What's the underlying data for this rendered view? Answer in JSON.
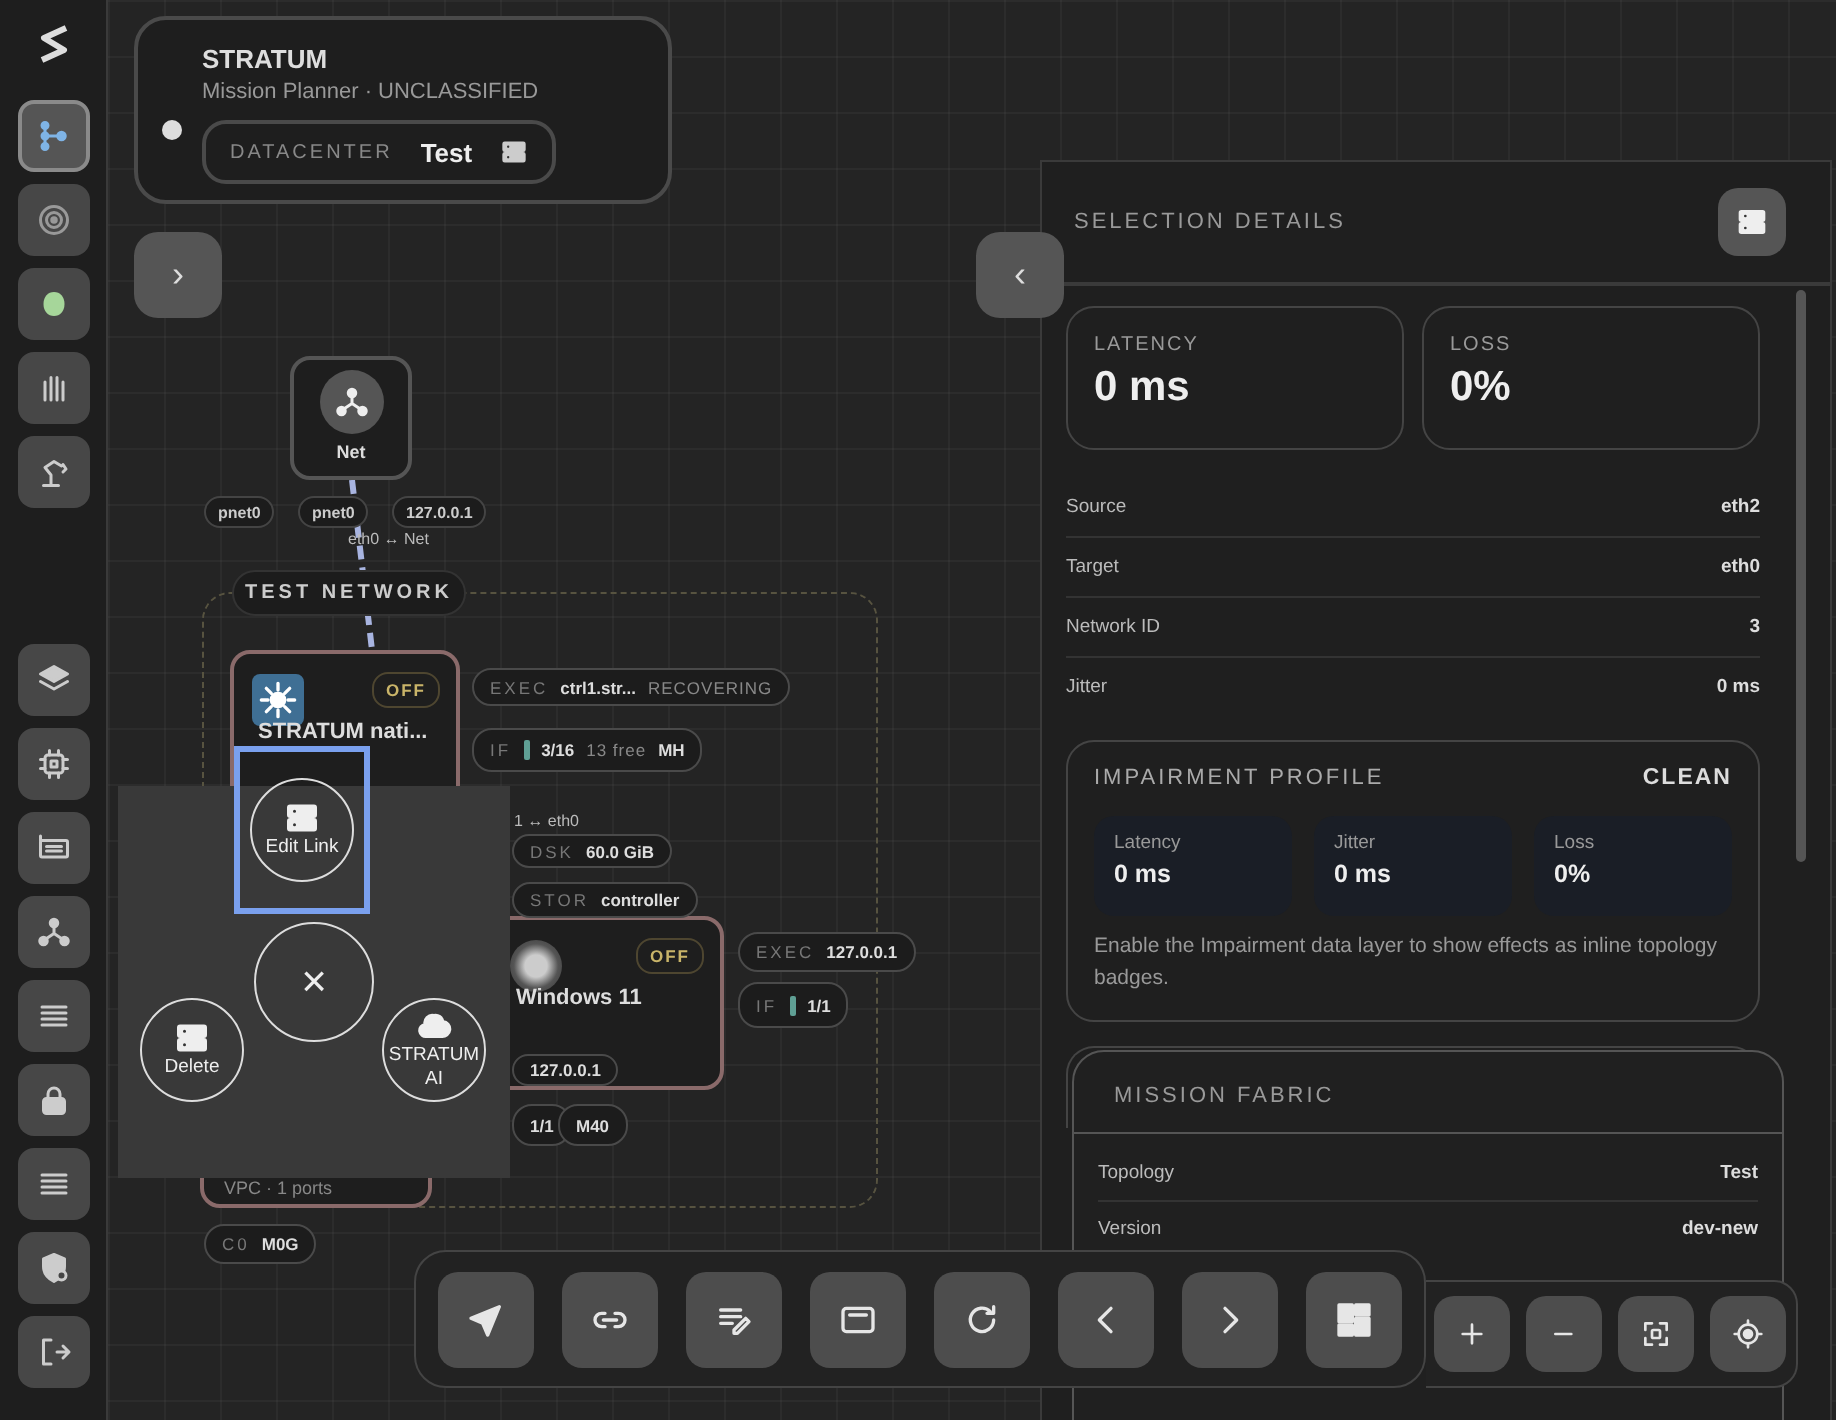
{
  "sidebar": {
    "top": [
      {
        "selected": true
      },
      {
        "selected": false
      },
      {
        "selected": false
      },
      {
        "selected": false
      },
      {
        "selected": false
      }
    ],
    "bottom": [
      {
        "selected": false
      },
      {
        "selected": false
      },
      {
        "selected": false
      },
      {
        "selected": false
      },
      {
        "selected": false
      },
      {
        "selected": false
      },
      {
        "selected": false
      },
      {
        "selected": false
      },
      {
        "selected": false
      }
    ]
  },
  "header": {
    "title": "STRATUM",
    "subtitle": "Mission Planner · UNCLASSIFIED",
    "datacenter_label": "DATACENTER",
    "datacenter_value": "Test"
  },
  "expand_button": "›",
  "collapse_button": "‹",
  "canvas": {
    "net_node": {
      "label": "Net"
    },
    "net_ports": [
      "pnet0",
      "pnet0",
      "127.0.0.1"
    ],
    "link_labels": [
      "eth0 ↔ Net",
      "1 ↔ eth0"
    ],
    "group": {
      "label": "TEST NETWORK"
    },
    "nodes": [
      {
        "kind": "controller",
        "title": "STRATUM nati...",
        "status": "OFF"
      },
      {
        "kind": "disk",
        "title": "Windows 11",
        "status": "OFF"
      },
      {
        "kind": "plain",
        "footer": "VPC · 1 ports"
      }
    ],
    "badges": [
      {
        "label": "EXEC",
        "value": "ctrl1.str...",
        "extra": "RECOVERING"
      },
      {
        "label": "IF",
        "meter": true,
        "value": "3/16",
        "extra": "13 free",
        "tail": "MH"
      },
      {
        "label": "DSK",
        "value": "60.0 GiB"
      },
      {
        "label": "STOR",
        "value": "controller"
      },
      {
        "label": "EXEC",
        "value": "127.0.0.1"
      },
      {
        "label": "IF",
        "meter": true,
        "value": "1/1"
      },
      {
        "value": "127.0.0.1"
      },
      {
        "value": "1/1"
      },
      {
        "value": "M40"
      },
      {
        "label": "C0",
        "value": "M0G"
      }
    ]
  },
  "context_menu": {
    "close": "×",
    "items": [
      {
        "label": "Edit Link",
        "selected": true
      },
      {
        "label": "Delete",
        "selected": false
      },
      {
        "label": "STRATUM AI",
        "selected": false
      }
    ]
  },
  "details": {
    "title": "SELECTION DETAILS",
    "metrics": [
      {
        "label": "LATENCY",
        "value": "0 ms"
      },
      {
        "label": "LOSS",
        "value": "0%"
      }
    ],
    "rows": [
      {
        "label": "Source",
        "value": "eth2"
      },
      {
        "label": "Target",
        "value": "eth0"
      },
      {
        "label": "Network ID",
        "value": "3"
      },
      {
        "label": "Jitter",
        "value": "0 ms"
      }
    ],
    "impairment": {
      "title": "IMPAIRMENT PROFILE",
      "status": "CLEAN",
      "metrics": [
        {
          "label": "Latency",
          "value": "0 ms"
        },
        {
          "label": "Jitter",
          "value": "0 ms"
        },
        {
          "label": "Loss",
          "value": "0%"
        }
      ],
      "note": "Enable the Impairment data layer to show effects as inline topology badges."
    },
    "fabric": {
      "title": "MISSION FABRIC",
      "rows": [
        {
          "label": "Topology",
          "value": "Test"
        },
        {
          "label": "Version",
          "value": "dev-new"
        }
      ]
    }
  }
}
